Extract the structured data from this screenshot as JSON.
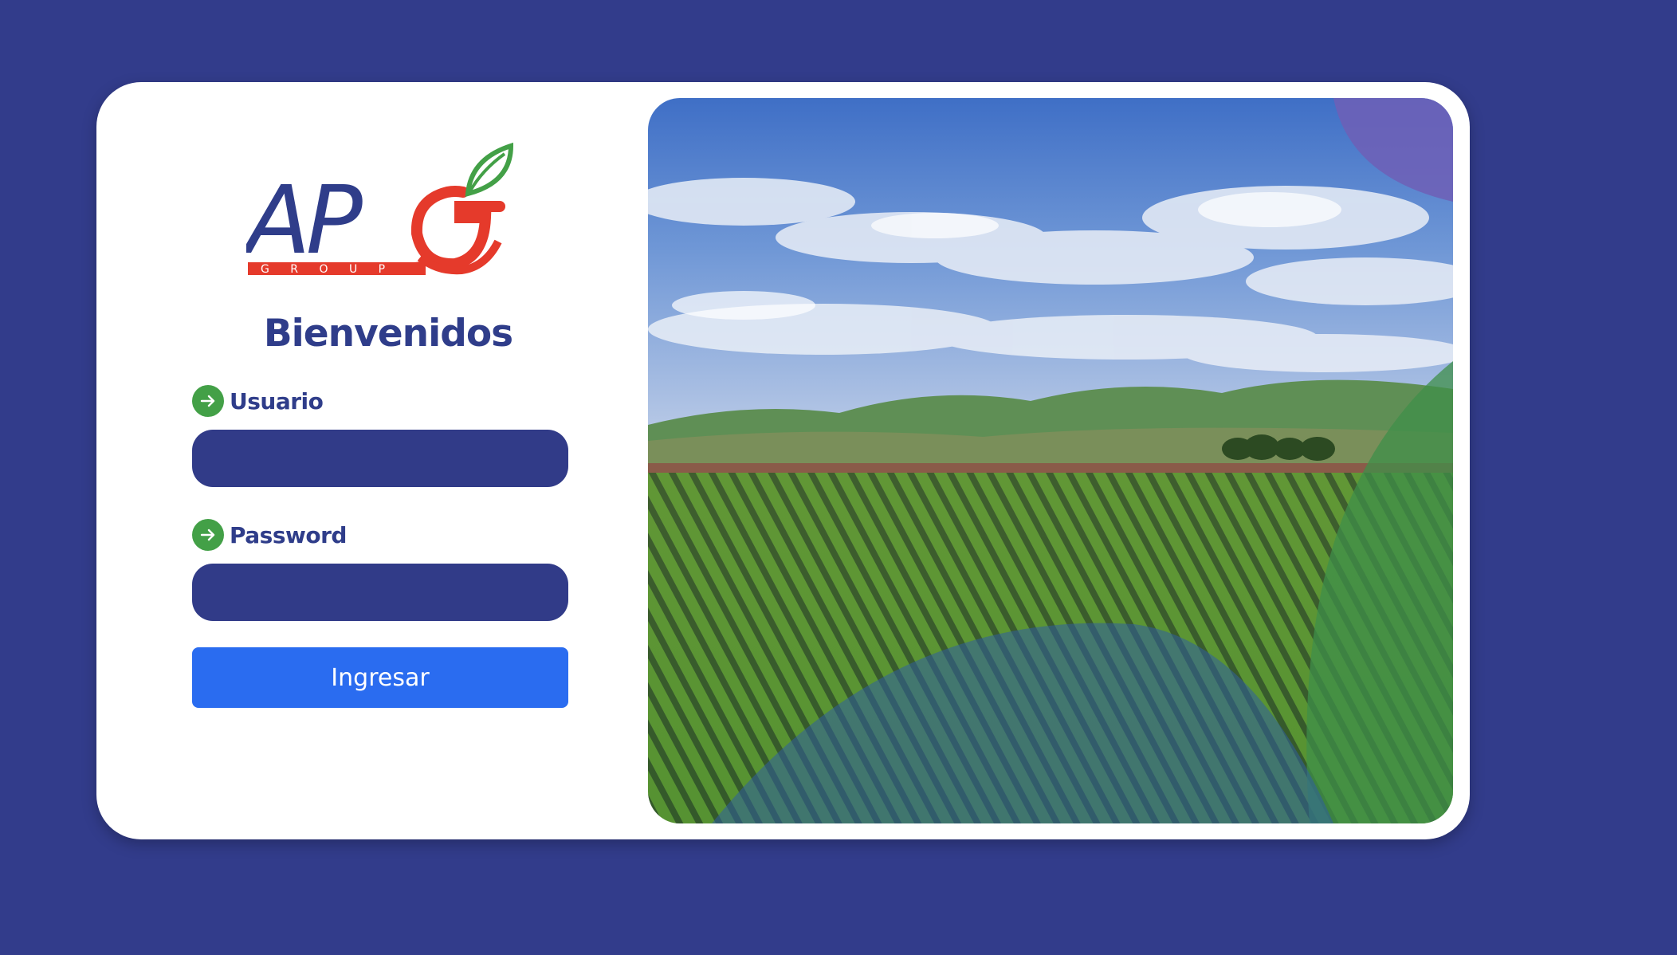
{
  "app": {
    "title": "APG GROUP",
    "welcome": "Bienvenidos"
  },
  "logo": {
    "letters": "AP",
    "group_text": "G R O U P",
    "icon": "apple-leaf-logo"
  },
  "form": {
    "username_label": "Usuario",
    "username_value": "",
    "password_label": "Password",
    "password_value": "",
    "submit_label": "Ingresar",
    "label_icon": "arrow-right-circle-icon"
  },
  "colors": {
    "background": "#323c8b",
    "primary": "#2f3d8a",
    "accent_green": "#43a047",
    "button": "#2a6cf0",
    "logo_red": "#e53a2b"
  },
  "hero": {
    "image": "farm-field-landscape"
  }
}
